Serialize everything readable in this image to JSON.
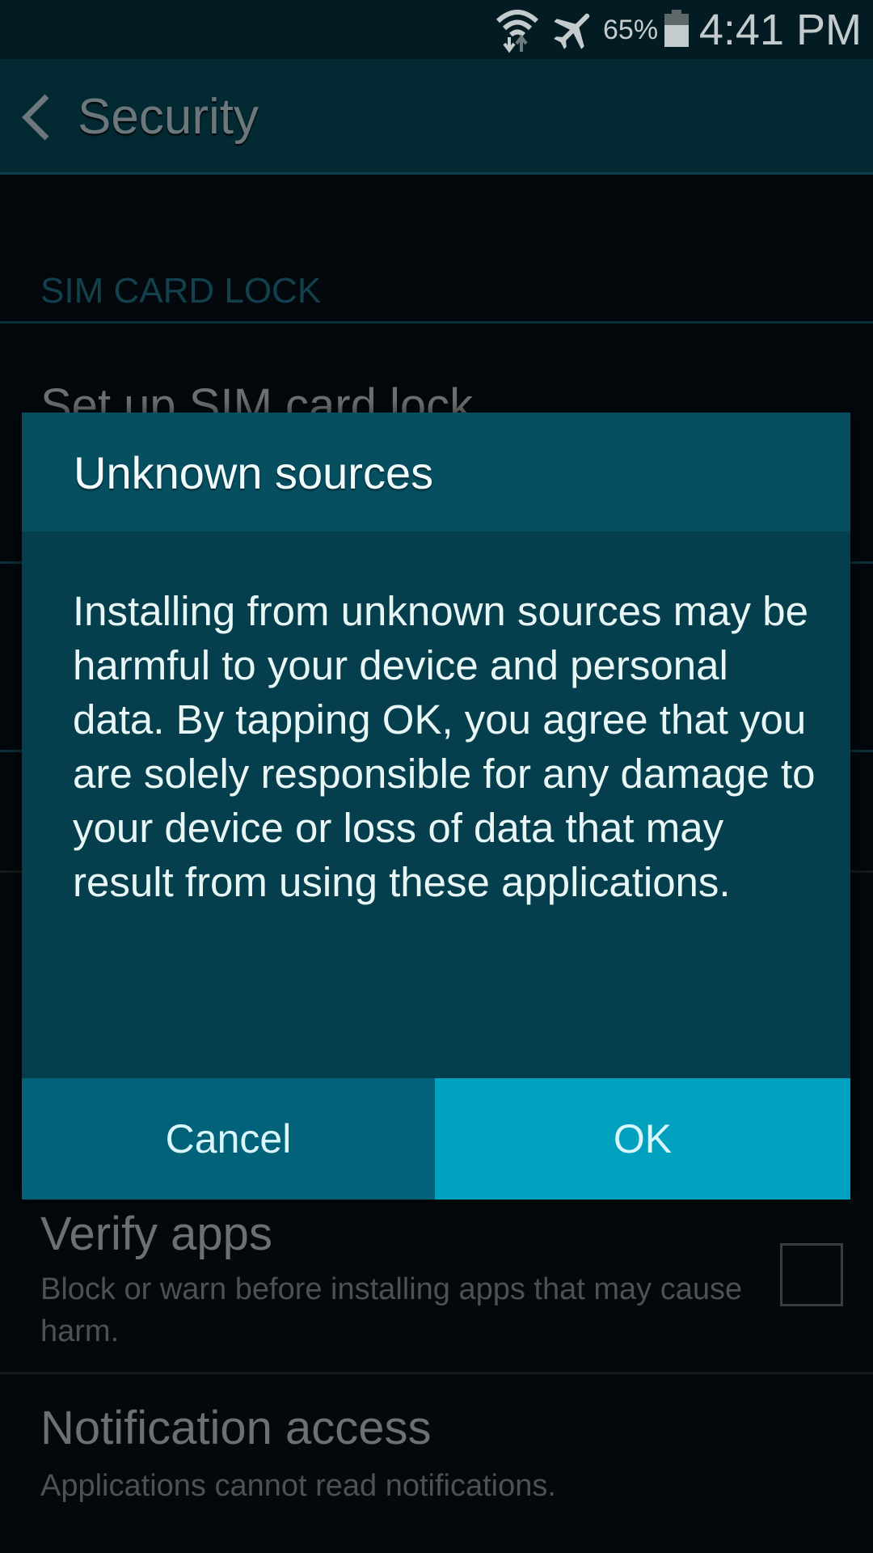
{
  "status_bar": {
    "battery_percent": "65%",
    "battery_level": 0.65,
    "time": "4:41 PM",
    "icons": [
      "wifi-icon",
      "airplane-mode-icon",
      "battery-icon"
    ]
  },
  "header": {
    "back_icon": "chevron-left-icon",
    "title": "Security"
  },
  "list": {
    "section_header": "SIM CARD LOCK",
    "items": [
      {
        "title": "Set up SIM card lock"
      },
      {
        "title": "Verify apps",
        "subtitle": "Block or warn before installing apps that may cause harm.",
        "checked": false
      },
      {
        "title": "Notification access",
        "subtitle": "Applications cannot read notifications."
      }
    ]
  },
  "dialog": {
    "title": "Unknown sources",
    "message": "Installing from unknown sources may be harmful to your device and personal data. By tapping OK, you agree that you are solely responsible for any damage to your device or loss of data that may result from using these applications.",
    "cancel_label": "Cancel",
    "ok_label": "OK"
  },
  "colors": {
    "dialog_title_bg": "#054f60",
    "dialog_body_bg": "#053e4c",
    "cancel_bg": "#02627a",
    "ok_bg": "#00a0bf",
    "header_bg": "#032a33"
  }
}
